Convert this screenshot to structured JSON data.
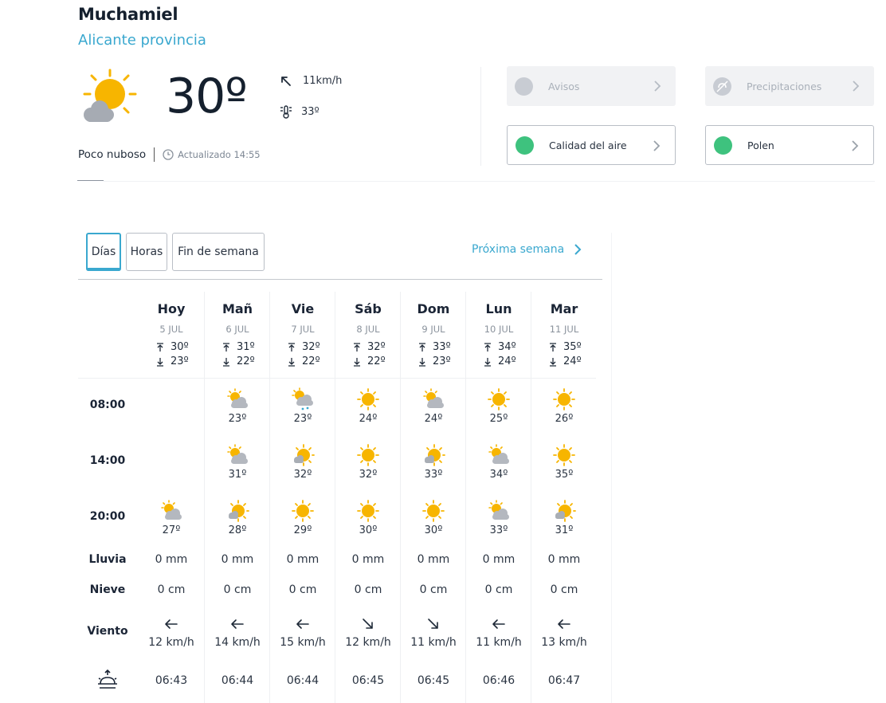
{
  "location": {
    "city": "Muchamiel",
    "province": "Alicante provincia"
  },
  "current": {
    "icon": "sun-cloud-icon",
    "temperature": "30º",
    "wind": "11km/h",
    "feels_like": "33º",
    "condition": "Poco nuboso",
    "updated": "Actualizado 14:55"
  },
  "cards": [
    {
      "label": "Avisos",
      "state": "disabled"
    },
    {
      "label": "Precipitaciones",
      "state": "disabled"
    },
    {
      "label": "Calidad del aire",
      "state": "active",
      "color": "#3ec27e"
    },
    {
      "label": "Polen",
      "state": "active",
      "color": "#3ec27e"
    }
  ],
  "tabs": [
    "Días",
    "Horas",
    "Fin de semana"
  ],
  "next_week": "Próxima semana",
  "row_labels": {
    "h1": "08:00",
    "h2": "14:00",
    "h3": "20:00",
    "rain": "Lluvia",
    "snow": "Nieve",
    "wind": "Viento"
  },
  "days": [
    {
      "name": "Hoy",
      "date": "5 JUL",
      "max": "30º",
      "min": "23º",
      "h1": null,
      "h2": null,
      "h3": {
        "icon": "sun-cloud-icon",
        "temp": "27º"
      },
      "rain": "0 mm",
      "snow": "0 cm",
      "wind_dir": "W",
      "wind": "12 km/h",
      "sunrise": "06:43"
    },
    {
      "name": "Mañ",
      "date": "6 JUL",
      "max": "31º",
      "min": "22º",
      "h1": {
        "icon": "sun-cloud-icon",
        "temp": "23º"
      },
      "h2": {
        "icon": "sun-cloud-icon",
        "temp": "31º"
      },
      "h3": {
        "icon": "sun-small-cloud-icon",
        "temp": "28º"
      },
      "rain": "0 mm",
      "snow": "0 cm",
      "wind_dir": "W",
      "wind": "14 km/h",
      "sunrise": "06:44"
    },
    {
      "name": "Vie",
      "date": "7 JUL",
      "max": "32º",
      "min": "22º",
      "h1": {
        "icon": "sun-cloud-rain-icon",
        "temp": "23º"
      },
      "h2": {
        "icon": "sun-small-cloud-icon",
        "temp": "32º"
      },
      "h3": {
        "icon": "sun-icon",
        "temp": "29º"
      },
      "rain": "0 mm",
      "snow": "0 cm",
      "wind_dir": "W",
      "wind": "15 km/h",
      "sunrise": "06:44"
    },
    {
      "name": "Sáb",
      "date": "8 JUL",
      "max": "32º",
      "min": "22º",
      "h1": {
        "icon": "sun-icon",
        "temp": "24º"
      },
      "h2": {
        "icon": "sun-icon",
        "temp": "32º"
      },
      "h3": {
        "icon": "sun-icon",
        "temp": "30º"
      },
      "rain": "0 mm",
      "snow": "0 cm",
      "wind_dir": "SE",
      "wind": "12 km/h",
      "sunrise": "06:45"
    },
    {
      "name": "Dom",
      "date": "9 JUL",
      "max": "33º",
      "min": "23º",
      "h1": {
        "icon": "sun-cloud-icon",
        "temp": "24º"
      },
      "h2": {
        "icon": "sun-small-cloud-icon",
        "temp": "33º"
      },
      "h3": {
        "icon": "sun-icon",
        "temp": "30º"
      },
      "rain": "0 mm",
      "snow": "0 cm",
      "wind_dir": "SE",
      "wind": "11 km/h",
      "sunrise": "06:45"
    },
    {
      "name": "Lun",
      "date": "10 JUL",
      "max": "34º",
      "min": "24º",
      "h1": {
        "icon": "sun-icon",
        "temp": "25º"
      },
      "h2": {
        "icon": "sun-cloud-icon",
        "temp": "34º"
      },
      "h3": {
        "icon": "sun-cloud-icon",
        "temp": "33º"
      },
      "rain": "0 mm",
      "snow": "0 cm",
      "wind_dir": "W",
      "wind": "11 km/h",
      "sunrise": "06:46"
    },
    {
      "name": "Mar",
      "date": "11 JUL",
      "max": "35º",
      "min": "24º",
      "h1": {
        "icon": "sun-icon",
        "temp": "26º"
      },
      "h2": {
        "icon": "sun-icon",
        "temp": "35º"
      },
      "h3": {
        "icon": "sun-small-cloud-icon",
        "temp": "31º"
      },
      "rain": "0 mm",
      "snow": "0 cm",
      "wind_dir": "W",
      "wind": "13 km/h",
      "sunrise": "06:47"
    }
  ],
  "colors": {
    "accent": "#3aa8cf",
    "sun": "#f7b500",
    "cloud": "#b6bac1",
    "good": "#3ec27e"
  }
}
